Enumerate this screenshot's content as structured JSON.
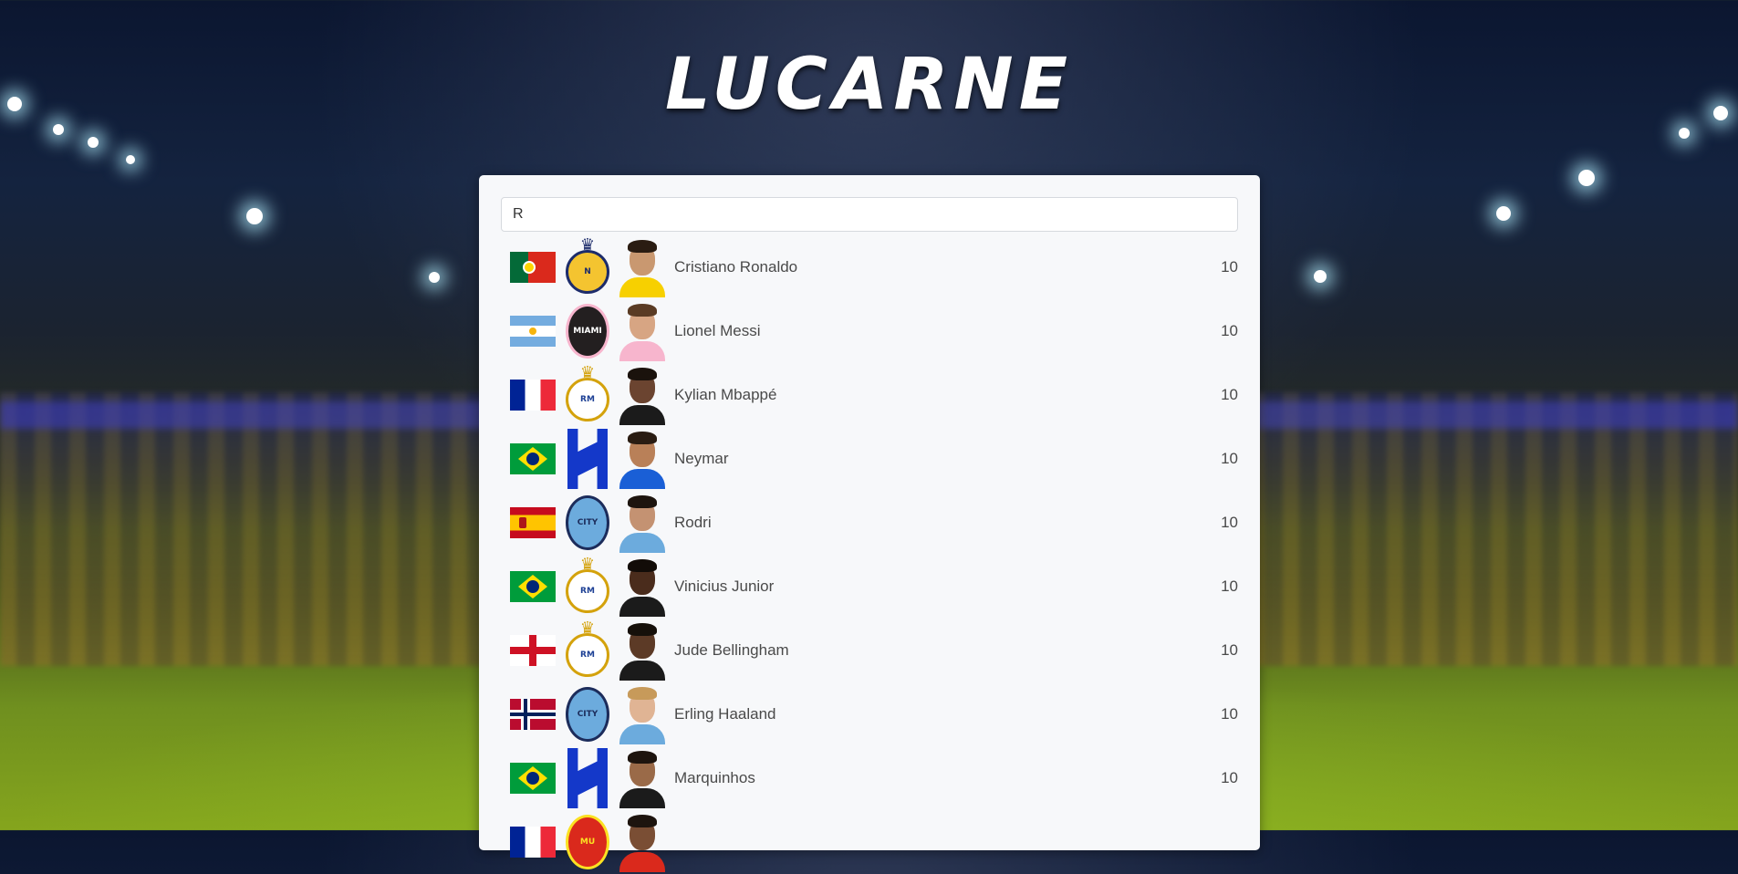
{
  "app": {
    "title": "LUCARNE"
  },
  "search": {
    "value": "R",
    "placeholder": ""
  },
  "players": [
    {
      "name": "Cristiano Ronaldo",
      "score": "10",
      "flag": "portugal",
      "club": "al-nassr"
    },
    {
      "name": "Lionel Messi",
      "score": "10",
      "flag": "argentina",
      "club": "inter-miami"
    },
    {
      "name": "Kylian Mbappé",
      "score": "10",
      "flag": "france",
      "club": "real-madrid"
    },
    {
      "name": "Neymar",
      "score": "10",
      "flag": "brazil",
      "club": "al-hilal"
    },
    {
      "name": "Rodri",
      "score": "10",
      "flag": "spain",
      "club": "manchester-city"
    },
    {
      "name": "Vinicius Junior",
      "score": "10",
      "flag": "brazil",
      "club": "real-madrid"
    },
    {
      "name": "Jude Bellingham",
      "score": "10",
      "flag": "england",
      "club": "real-madrid"
    },
    {
      "name": "Erling Haaland",
      "score": "10",
      "flag": "norway",
      "club": "manchester-city"
    },
    {
      "name": "Marquinhos",
      "score": "10",
      "flag": "brazil",
      "club": "al-hilal"
    },
    {
      "name": "",
      "score": "",
      "flag": "france",
      "club": "manchester-united"
    }
  ],
  "colors": {
    "panel": "#f7f8fa",
    "text": "#4a4a4a",
    "title": "#ffffff"
  }
}
